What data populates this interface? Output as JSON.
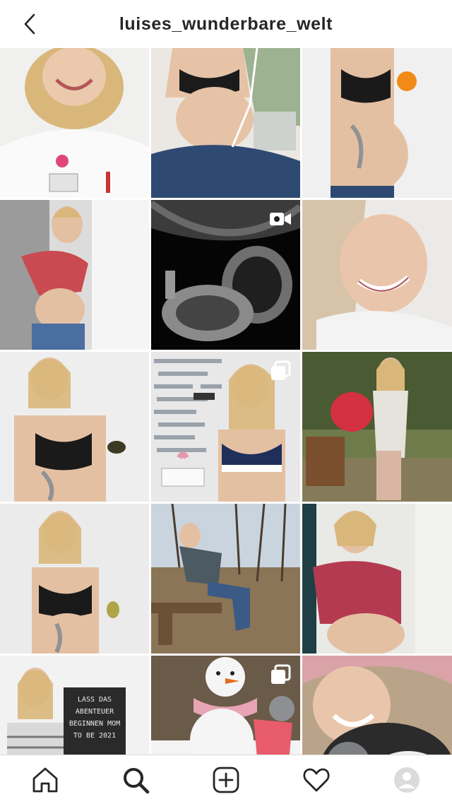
{
  "header": {
    "username": "luises_wunderbare_welt",
    "back_icon": "chevron-left-icon"
  },
  "posts": [
    {
      "id": "p1",
      "type": "photo",
      "scene": "nurse-selfie",
      "colors": [
        "#f1f1f1",
        "#d9b77a"
      ]
    },
    {
      "id": "p2",
      "type": "photo",
      "scene": "ultrasound-home",
      "colors": [
        "#e9e6e1",
        "#1d1d1d"
      ]
    },
    {
      "id": "p3",
      "type": "photo",
      "scene": "orange-bump",
      "colors": [
        "#eeeeee",
        "#f28a17"
      ]
    },
    {
      "id": "p4",
      "type": "photo",
      "scene": "red-top",
      "colors": [
        "#d7d7d7",
        "#c9484c"
      ]
    },
    {
      "id": "p5",
      "type": "video",
      "scene": "ultrasound-scan",
      "badge_icon": "video-icon",
      "colors": [
        "#0a0a0a",
        "#8c8c8c"
      ]
    },
    {
      "id": "p6",
      "type": "photo",
      "scene": "smile-closeup",
      "colors": [
        "#ece9e7",
        "#c9a07a"
      ]
    },
    {
      "id": "p7",
      "type": "photo",
      "scene": "avocado",
      "colors": [
        "#eeeeee",
        "#1a1a1a"
      ]
    },
    {
      "id": "p8",
      "type": "carousel",
      "scene": "city-wall",
      "badge_icon": "carousel-icon",
      "colors": [
        "#e6e6e6",
        "#1f2f5c"
      ]
    },
    {
      "id": "p9",
      "type": "photo",
      "scene": "roses-garden",
      "colors": [
        "#6f7b4a",
        "#d33040"
      ]
    },
    {
      "id": "p10",
      "type": "photo",
      "scene": "pear",
      "colors": [
        "#ececec",
        "#1a1a1a"
      ]
    },
    {
      "id": "p11",
      "type": "photo",
      "scene": "forest-bench",
      "colors": [
        "#9a8f7a",
        "#3b5a86"
      ]
    },
    {
      "id": "p12",
      "type": "photo",
      "scene": "red-dress",
      "colors": [
        "#e9e9e5",
        "#b43a52"
      ]
    },
    {
      "id": "p13",
      "type": "photo",
      "scene": "letterboard",
      "colors": [
        "#f2f2f2",
        "#2a2a2a"
      ],
      "sign_text": "LASS DAS ABENTEUER BEGINNEN MOM TO BE 2021"
    },
    {
      "id": "p14",
      "type": "carousel",
      "scene": "snowman",
      "badge_icon": "carousel-icon",
      "colors": [
        "#d9d8d6",
        "#e85b6a"
      ]
    },
    {
      "id": "p15",
      "type": "photo",
      "scene": "dog-closeup",
      "colors": [
        "#b9a48a",
        "#2a2a2a"
      ]
    }
  ],
  "tabbar": {
    "items": [
      {
        "name": "home",
        "icon": "home-icon"
      },
      {
        "name": "search",
        "icon": "search-icon",
        "active": true
      },
      {
        "name": "new-post",
        "icon": "plus-square-icon"
      },
      {
        "name": "activity",
        "icon": "heart-icon"
      },
      {
        "name": "profile",
        "icon": "avatar-icon"
      }
    ]
  }
}
